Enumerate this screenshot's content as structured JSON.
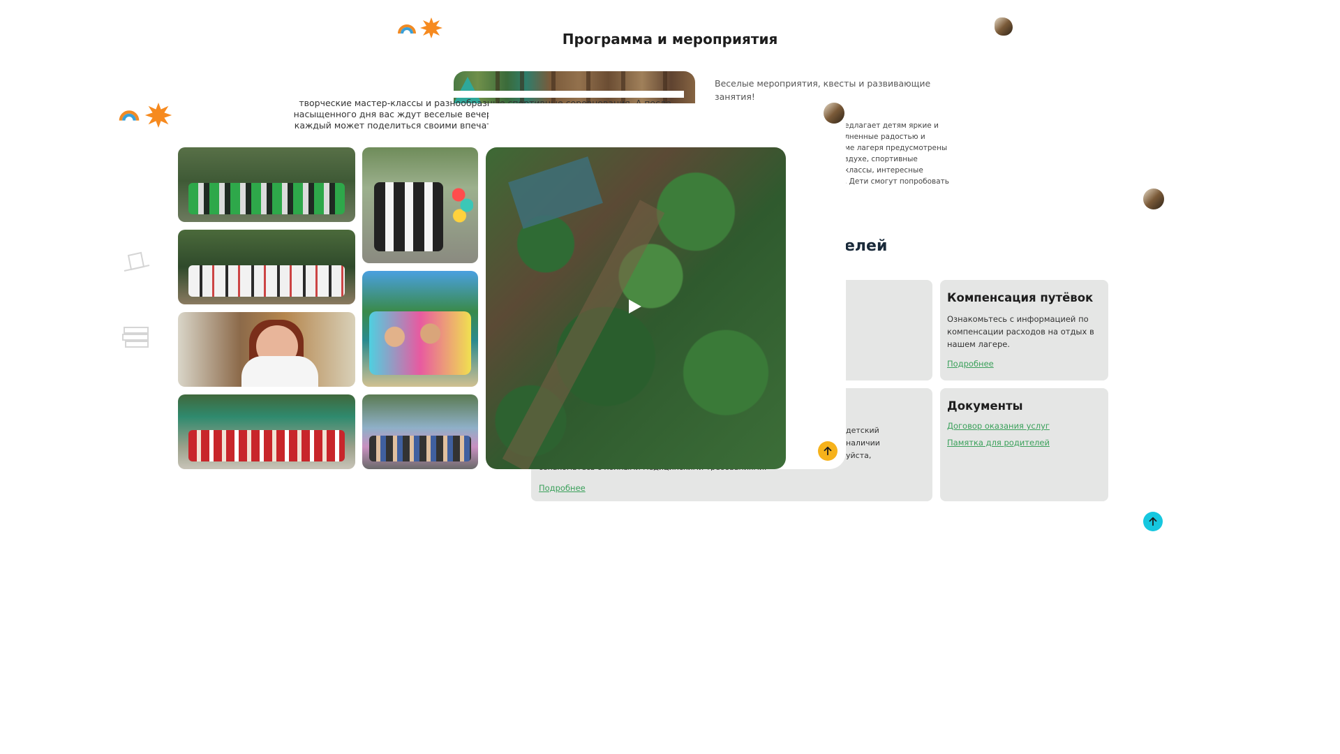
{
  "page": {
    "title": "Программа и мероприятия",
    "hero_caption": "Веселые мероприятия, квесты и развивающие занятия!",
    "intro_lines": [
      "творческие мастер-классы и разнообразные спортивные соревнования. А после",
      "насыщенного дня вас ждут веселые вечеринки у костра под звездным небом, где",
      "каждый может поделиться своими впечатлениями и увлекательными историями."
    ],
    "side_text_lines": [
      "едлагает детям яркие и",
      "лненные радостью и",
      "ме лагеря предусмотрены",
      "здухе, спортивные",
      "классы, интересные",
      ". Дети смогут попробовать"
    ],
    "parents_title": "елей"
  },
  "cards": {
    "compensation": {
      "title": "Компенсация путёвок",
      "text": "Ознакомьтесь с информацией по компенсации расходов на отдых в нашем лагере.",
      "more": "Подробнее"
    },
    "documents": {
      "title": "Документы",
      "links": [
        "Договор оказания услуг",
        "Памятка для родителей"
      ]
    },
    "medical": {
      "text_lines": [
        "детский",
        "наличии",
        "уйста,"
      ],
      "bottom_line": "ознакомьтесь с полными медицинскими требованиями.",
      "more": "Подробнее"
    }
  },
  "gallery": {
    "photos": [
      "photo-group-green",
      "photo-group-white",
      "photo-girl-portrait",
      "photo-dance-stage",
      "photo-dancing-girls",
      "photo-holi-friends",
      "photo-color-festival"
    ],
    "video": {
      "icon": "play-icon"
    }
  },
  "colors": {
    "accent_green": "#3aa05a",
    "card_bg": "#e5e6e5",
    "up_orange": "#f6b21b",
    "up_teal": "#16c7df"
  }
}
